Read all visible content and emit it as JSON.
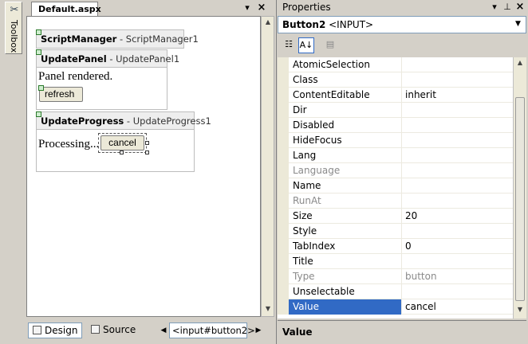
{
  "toolbox": {
    "label": "Toolbox",
    "icon": "toolbox-icon"
  },
  "editor": {
    "tab_title": "Default.aspx",
    "dropdown_glyph": "▾",
    "close_glyph": "×",
    "controls": {
      "scriptmanager": {
        "type": "ScriptManager",
        "sep": " - ",
        "id": "ScriptManager1"
      },
      "updatepanel": {
        "type": "UpdatePanel",
        "sep": " - ",
        "id": "UpdatePanel1",
        "text": "Panel rendered.",
        "button": "refresh"
      },
      "updateprogress": {
        "type": "UpdateProgress",
        "sep": " - ",
        "id": "UpdateProgress1",
        "text": "Processing...",
        "button": "cancel"
      }
    },
    "view_design": "Design",
    "view_source": "Source",
    "tag_crumb": "<input#button2>"
  },
  "properties": {
    "title": "Properties",
    "object_name": "Button2",
    "object_type": " <INPUT>",
    "description_title": "Value",
    "rows": [
      {
        "name": "AtomicSelection",
        "value": ""
      },
      {
        "name": "Class",
        "value": ""
      },
      {
        "name": "ContentEditable",
        "value": "inherit"
      },
      {
        "name": "Dir",
        "value": ""
      },
      {
        "name": "Disabled",
        "value": ""
      },
      {
        "name": "HideFocus",
        "value": ""
      },
      {
        "name": "Lang",
        "value": ""
      },
      {
        "name": "Language",
        "value": ""
      },
      {
        "name": "Name",
        "value": ""
      },
      {
        "name": "RunAt",
        "value": ""
      },
      {
        "name": "Size",
        "value": "20"
      },
      {
        "name": "Style",
        "value": ""
      },
      {
        "name": "TabIndex",
        "value": "0"
      },
      {
        "name": "Title",
        "value": ""
      },
      {
        "name": "Type",
        "value": "button"
      },
      {
        "name": "Unselectable",
        "value": ""
      },
      {
        "name": "Value",
        "value": "cancel"
      }
    ]
  },
  "colors": {
    "selection": "#316ac5",
    "chrome": "#d4d0c8",
    "disabled_text": "#8a8a8a"
  }
}
